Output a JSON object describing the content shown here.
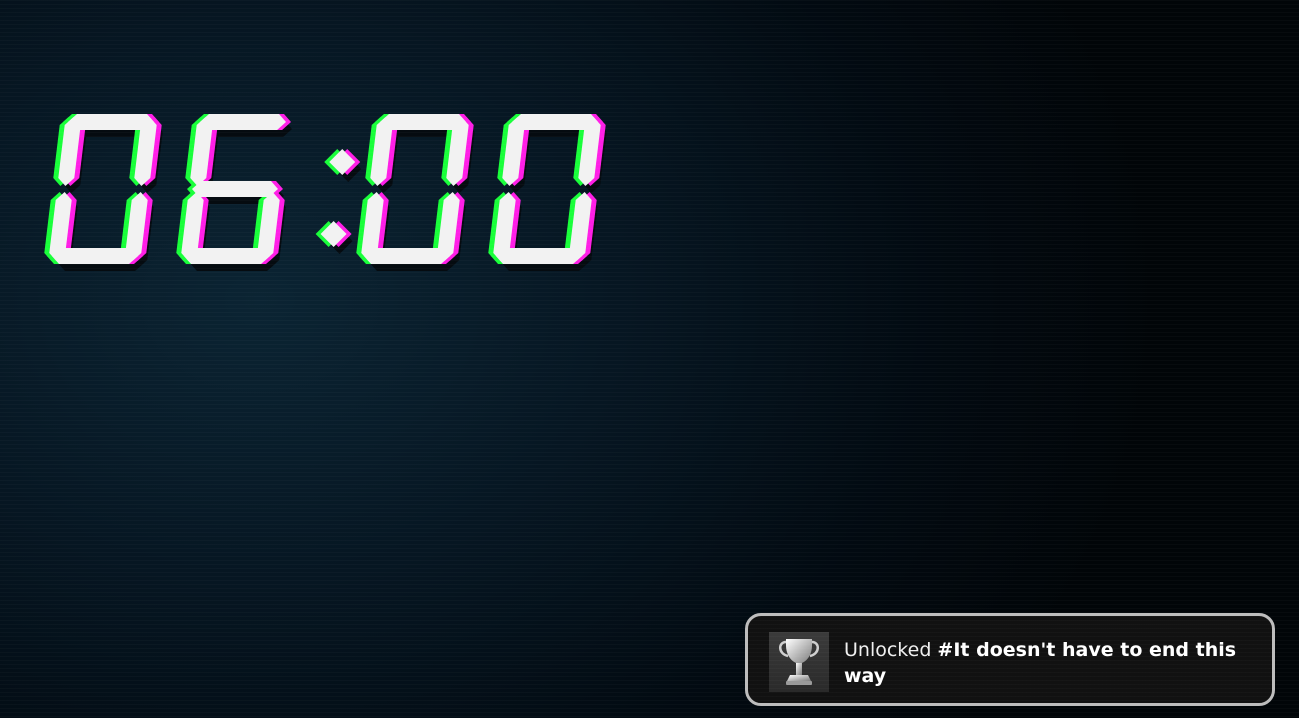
{
  "clock": {
    "time": "06:00",
    "colors": {
      "segment": "#f2f2f2",
      "glitch_left": "#19ff3a",
      "glitch_right": "#ff1ee6"
    }
  },
  "achievement_toast": {
    "prefix": "Unlocked",
    "title": "#It doesn't have to end this way",
    "icon": "trophy-icon"
  }
}
